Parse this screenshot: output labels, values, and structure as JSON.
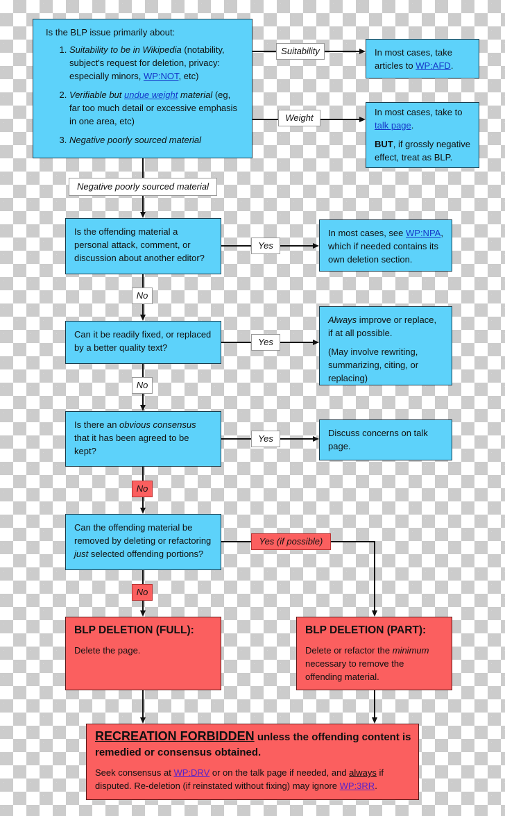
{
  "colors": {
    "question_box": "#5dd2fa",
    "deletion_box": "#fb5f5f",
    "line": "#111111",
    "link": "#1538c8"
  },
  "start": {
    "intro": "Is the BLP issue primarily about:",
    "items": [
      {
        "em": "Suitability to be in Wikipedia",
        "text": " (notability, subject's request for deletion, privacy: especially minors, ",
        "link": "WP:NOT",
        "tail": ", etc)"
      },
      {
        "em": "Verifiable but ",
        "link": "undue weight",
        "em2": " material",
        "text": " (eg, far too much detail or excessive emphasis in one area, etc)"
      },
      {
        "em": "Negative poorly sourced material"
      }
    ]
  },
  "edges": {
    "suitability": "Suitability",
    "weight": "Weight",
    "negative": "Negative poorly sourced material",
    "yes": "Yes",
    "no": "No",
    "yes_if_possible": "Yes (if possible)"
  },
  "suitability_box": {
    "text": "In most cases, take articles to ",
    "link": "WP:AFD",
    "tail": "."
  },
  "weight_box": {
    "text": "In most cases, take to ",
    "link": "talk page",
    "tail": ".",
    "bold": "BUT",
    "text2": ", if grossly negative effect, treat as BLP."
  },
  "q1": {
    "text": "Is the offending material a personal attack, comment, or discussion about another editor?"
  },
  "a1": {
    "text": "In most cases, see ",
    "link": "WP:NPA",
    "tail": ", which if needed contains its own deletion section."
  },
  "q2": {
    "text": "Can it be readily fixed, or replaced by a better quality text?"
  },
  "a2": {
    "em": "Always",
    "text": " improve or replace, if at all possible.",
    "text2": "(May involve rewriting, summarizing, citing, or replacing)"
  },
  "q3": {
    "text": "Is there an ",
    "em": "obvious consensus",
    "tail": " that it has been agreed to be kept?"
  },
  "a3": {
    "text": "Discuss concerns on talk page."
  },
  "q4": {
    "text": "Can the offending material be removed by deleting or refactoring ",
    "em": "just",
    "tail": " selected offending portions?"
  },
  "full": {
    "title": "BLP DELETION (FULL):",
    "text": "Delete the page."
  },
  "part": {
    "title": "BLP DELETION (PART):",
    "text": "Delete or refactor the ",
    "em": "minimum",
    "tail": " necessary to remove the offending material."
  },
  "final": {
    "title": "RECREATION FORBIDDEN",
    "title_tail": " unless the offending content is",
    "title_line2": "remedied or consensus obtained.",
    "text": "Seek consensus at ",
    "link1": "WP:DRV",
    "text2": " or on the talk page if needed, and ",
    "u": "always",
    "text3": " if disputed. Re-deletion (if reinstated without fixing) may ignore ",
    "link2": "WP:3RR",
    "tail": "."
  }
}
